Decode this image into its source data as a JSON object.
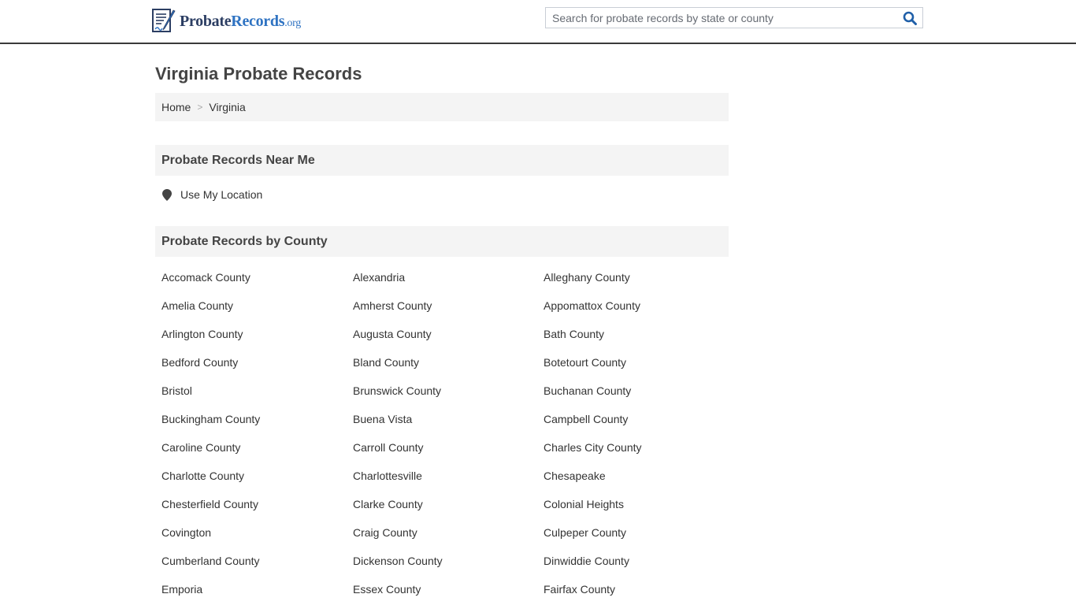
{
  "header": {
    "logo": {
      "part1": "Probate",
      "part2": "Records",
      "part3": ".org"
    },
    "search": {
      "placeholder": "Search for probate records by state or county",
      "value": ""
    }
  },
  "page": {
    "title": "Virginia Probate Records",
    "breadcrumb": [
      {
        "label": "Home"
      },
      {
        "label": "Virginia"
      }
    ],
    "breadcrumb_separator": ">"
  },
  "near_me": {
    "heading": "Probate Records Near Me",
    "use_location_label": "Use My Location"
  },
  "by_county": {
    "heading": "Probate Records by County",
    "counties": [
      "Accomack County",
      "Alexandria",
      "Alleghany County",
      "Amelia County",
      "Amherst County",
      "Appomattox County",
      "Arlington County",
      "Augusta County",
      "Bath County",
      "Bedford County",
      "Bland County",
      "Botetourt County",
      "Bristol",
      "Brunswick County",
      "Buchanan County",
      "Buckingham County",
      "Buena Vista",
      "Campbell County",
      "Caroline County",
      "Carroll County",
      "Charles City County",
      "Charlotte County",
      "Charlottesville",
      "Chesapeake",
      "Chesterfield County",
      "Clarke County",
      "Colonial Heights",
      "Covington",
      "Craig County",
      "Culpeper County",
      "Cumberland County",
      "Dickenson County",
      "Dinwiddie County",
      "Emporia",
      "Essex County",
      "Fairfax County"
    ]
  },
  "colors": {
    "brand_dark": "#2c3e63",
    "brand_blue": "#2f73c2",
    "panel_bg": "#f4f4f4",
    "search_icon": "#1f5fa8"
  }
}
